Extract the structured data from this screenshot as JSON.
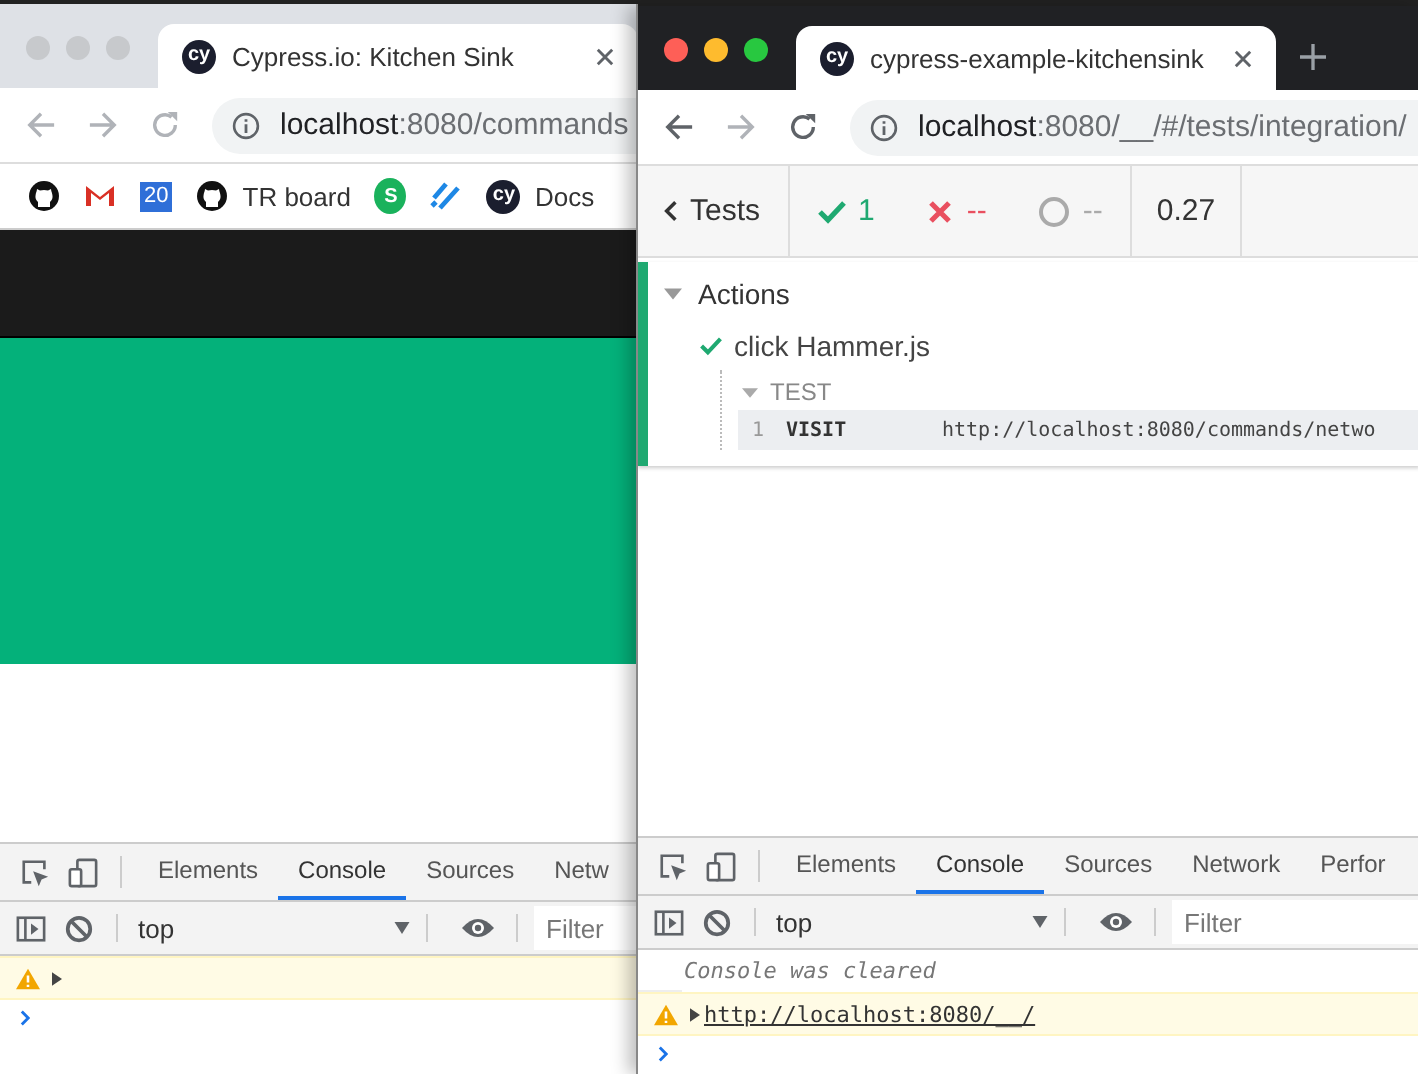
{
  "windows": [
    {
      "kind": "kitchen_sink",
      "focused": false,
      "tab": {
        "icon_text": "cy",
        "title": "Cypress.io: Kitchen Sink"
      },
      "address": {
        "host": "localhost",
        "path": ":8080/commands"
      },
      "bookmarks": [
        {
          "kind": "github"
        },
        {
          "kind": "gmail"
        },
        {
          "kind": "calendar",
          "icon_text": "20"
        },
        {
          "kind": "github",
          "label": "TR board"
        },
        {
          "kind": "evernote",
          "icon_text": "S"
        },
        {
          "kind": "stripes"
        },
        {
          "kind": "cypress",
          "icon_text": "cy",
          "label": "Docs"
        }
      ],
      "devtools": {
        "tabs": [
          {
            "label": "Elements",
            "selected": false
          },
          {
            "label": "Console",
            "selected": true
          },
          {
            "label": "Sources",
            "selected": false
          },
          {
            "label": "Netw",
            "selected": false
          }
        ],
        "context": "top",
        "filter_placeholder": "Filter",
        "messages": [
          {
            "kind": "warning"
          }
        ]
      }
    },
    {
      "kind": "runner",
      "focused": true,
      "new_tab": true,
      "tab": {
        "icon_text": "cy",
        "title": "cypress-example-kitchensink"
      },
      "address": {
        "host": "localhost",
        "path": ":8080/__/#/tests/integration/"
      },
      "reporter": {
        "back_label": "Tests",
        "passed": "1",
        "failed": "--",
        "pending": "--",
        "duration": "0.27",
        "suite": {
          "title": "Actions",
          "expanded": true,
          "test": {
            "title": "click Hammer.js",
            "passed": true,
            "hook": {
              "title": "TEST",
              "expanded": true,
              "commands": [
                {
                  "number": "1",
                  "name": "VISIT",
                  "message": "http://localhost:8080/commands/netwo"
                }
              ]
            }
          }
        }
      },
      "devtools": {
        "tabs": [
          {
            "label": "Elements",
            "selected": false
          },
          {
            "label": "Console",
            "selected": true
          },
          {
            "label": "Sources",
            "selected": false
          },
          {
            "label": "Network",
            "selected": false
          },
          {
            "label": "Perfor",
            "selected": false
          }
        ],
        "context": "top",
        "filter_placeholder": "Filter",
        "messages": [
          {
            "kind": "info",
            "text": "Console was cleared"
          },
          {
            "kind": "warning",
            "link": "http://localhost:8080/__/"
          }
        ]
      }
    }
  ]
}
